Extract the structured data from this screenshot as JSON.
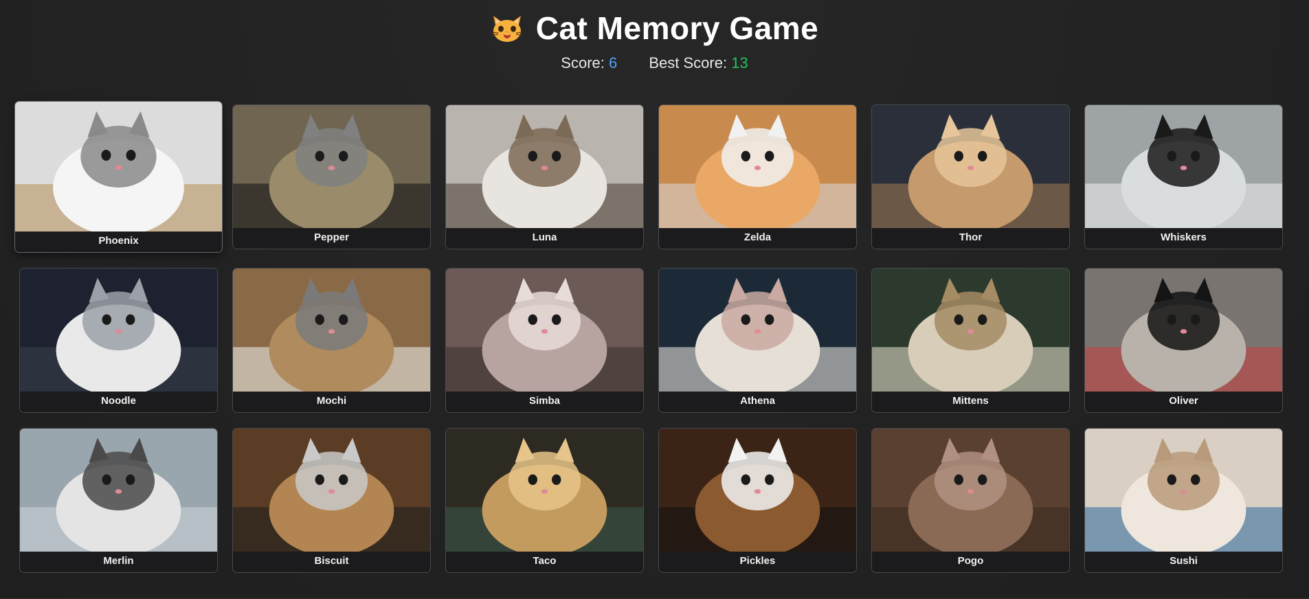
{
  "header": {
    "title": "Cat Memory Game",
    "logo_icon": "cat-face-icon",
    "score_label": "Score:",
    "score_value": "6",
    "best_label": "Best Score:",
    "best_value": "13"
  },
  "colors": {
    "background": "#232323",
    "score": "#4ea3ff",
    "best_score": "#22c55e",
    "card_border": "#4a4a4e"
  },
  "cards": [
    {
      "name": "Phoenix"
    },
    {
      "name": "Pepper"
    },
    {
      "name": "Luna"
    },
    {
      "name": "Zelda"
    },
    {
      "name": "Thor"
    },
    {
      "name": "Whiskers"
    },
    {
      "name": "Noodle"
    },
    {
      "name": "Mochi"
    },
    {
      "name": "Simba"
    },
    {
      "name": "Athena"
    },
    {
      "name": "Mittens"
    },
    {
      "name": "Oliver"
    },
    {
      "name": "Merlin"
    },
    {
      "name": "Biscuit"
    },
    {
      "name": "Taco"
    },
    {
      "name": "Pickles"
    },
    {
      "name": "Pogo"
    },
    {
      "name": "Sushi"
    }
  ]
}
